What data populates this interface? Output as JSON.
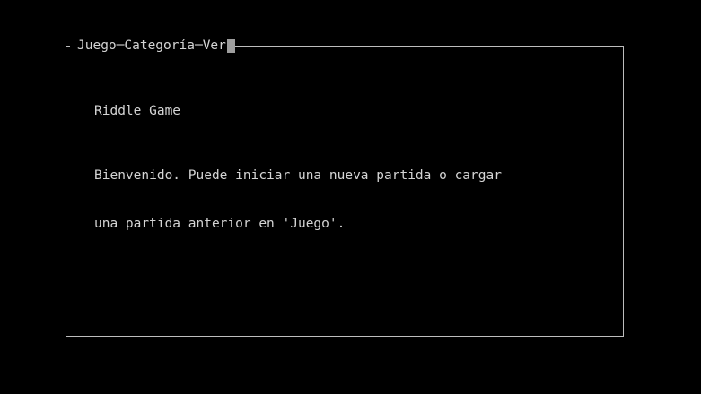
{
  "menu": {
    "items": [
      {
        "label": "Juego"
      },
      {
        "label": "Categoría"
      },
      {
        "label": "Ver"
      }
    ],
    "separator": "─"
  },
  "main": {
    "title": "Riddle Game",
    "message_lines": [
      "Bienvenido. Puede iniciar una nueva partida o cargar",
      "una partida anterior en 'Juego'."
    ]
  },
  "colors": {
    "background": "#000000",
    "text": "#d4d4d4",
    "border": "#bdbdbd",
    "cursor": "#9e9e9e"
  }
}
